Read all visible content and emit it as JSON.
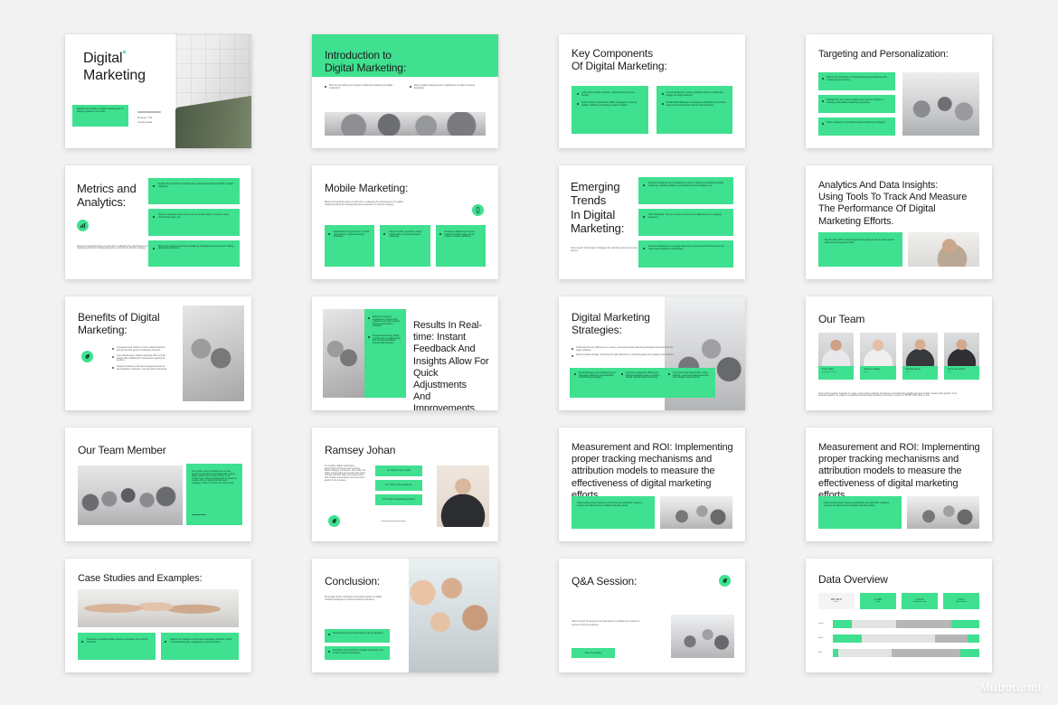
{
  "meta": {
    "watermark": "Mubou.net",
    "accent": "#3fe08f",
    "background": "#f2f2f2",
    "slide_bg": "#ffffff",
    "text_color": "#1b1b1b",
    "columns": 4,
    "rows": 5,
    "slide_count": 20
  },
  "slides": [
    {
      "index": 1,
      "name": "cover",
      "title_line1": "Digital",
      "title_line2": "Marketing",
      "green_block_text": "Highlight the benefits of digital marketing and its lasting relevance in the future.",
      "byline_line1": "Presenter: Visit",
      "byline_line2": "Creative Media",
      "photo": "architecture-walkway"
    },
    {
      "index": 2,
      "name": "introduction",
      "title_line1": "Introduction to",
      "title_line2": "Digital Marketing:",
      "bullets": [
        "What are the differences between traditional marketing and digital marketing?",
        "Define digital marketing and its significance in today's business landscape."
      ],
      "photo": "celebrating-people"
    },
    {
      "index": 3,
      "name": "key-components",
      "title_line1": "Key Components",
      "title_line2": "Of Digital Marketing:",
      "bullets_left": [
        "Learn about website structure, mobile friendly and user-friendly.",
        "Search Engine Optimization (SEO): Strategies to improve website visibility and ranking on search engines."
      ],
      "bullets_right": [
        "Content Marketing: Creating valuable content to attract and engage the target audience.",
        "Social Media Marketing: Leveraging social platforms for brand awareness and customer connect with customers."
      ]
    },
    {
      "index": 4,
      "name": "targeting-personalization",
      "title": "Targeting and Personalization:",
      "bullets": [
        "Discuss the importance of understanding target audiences and creating buyer personas.",
        "Highlight the role of data analytics and customer insights in creating personalized marketing experiences.",
        "Share examples of successful targeted marketing campaigns."
      ],
      "photo": "team-at-table"
    },
    {
      "index": 5,
      "name": "metrics-analytics",
      "title_line1": "Metrics and",
      "title_line2": "Analytics:",
      "body": "Metrics and analytics play a crucial role in evaluating the effectiveness of a digital marketing efforts and making data driven decisions to optimize strategy.",
      "bullets": [
        "Explain the importance of tracking key performance indicators (KPIs) in digital marketing.",
        "Discuss commonly used metrics such as website traffic, conversion rates, click-through rates, etc.",
        "Show how analytics tools help in obtaining campaign performance and making data-driven decisions."
      ],
      "badge_icon": "chart-badge-icon"
    },
    {
      "index": 6,
      "name": "mobile-marketing",
      "title": "Mobile Marketing:",
      "body": "Metrics and analytics play a crucial role in evaluating the effectiveness of a digital marketing efforts and making data driven decisions to optimize strategy.",
      "cards": [
        "Emphasize the significance of mobile optimization in digital marketing strategies.",
        "Discuss mobile responsive design, mobile apps, and location-based marketing.",
        "Showcase statistics and trends related to mobile usage and its impact on digital marketing."
      ],
      "badge_icon": "mobile-badge-icon"
    },
    {
      "index": 7,
      "name": "emerging-trends",
      "title_line1": "Emerging",
      "title_line2": "Trends",
      "title_line3": "In Digital",
      "title_line4": "Marketing:",
      "body": "Voice Search Optimization: Strategies for optimizing content for voice search queries.",
      "bullets": [
        "Artificial Intelligence (AI) and Machine Learning: How AI is transforming digital marketing, including chatbots, personalized recommendations, etc.",
        "Video Marketing: The rise of video content and its effectiveness in engaging audiences.",
        "Influencer Marketing: Leveraging influencers to promote products/services and reach target audiences authentically."
      ]
    },
    {
      "index": 8,
      "name": "analytics-data-insights",
      "title_line1": "Analytics And Data Insights:",
      "title_line2": "Using Tools To Track And Measure",
      "title_line3": "The Performance Of Digital",
      "title_line4": "Marketing Efforts.",
      "green_block_text": "Pay Per Click (PPC) Advertising: Running targeted ads to reach specific audiences and generate traffic.",
      "photo": "man-with-coffee"
    },
    {
      "index": 9,
      "name": "benefits",
      "title_line1": "Benefits of Digital",
      "title_line2": "Marketing:",
      "bullets": [
        "Increased reach: Ability to reach a global audience and get the best group of marketing channels.",
        "Cost-effectiveness: Digital marketing offers a lower budget than traditional for businesses requiring all services.",
        "Targeted marketing: Precise ad targeting based on demographics, behaviors, interests and preferences."
      ],
      "badge_icon": "leaf-badge-icon",
      "photo": "office-workers"
    },
    {
      "index": 10,
      "name": "real-time-results",
      "title_line1": "Results In Real-",
      "title_line2": "time: Instant",
      "title_line3": "Feedback And",
      "title_line4": "Insights Allow For",
      "title_line5": "Quick Adjustments",
      "title_line6": "And Improvements.",
      "bullets": [
        "Enhanced customer engagement: Interact with customers and gain insights through personalized channels.",
        "Targeted advertising: Ability to reach and re-targeting ads with increasing fashions through data followers."
      ],
      "photo": "people-collaborating"
    },
    {
      "index": 11,
      "name": "digital-marketing-strategies",
      "title_line1": "Digital Marketing",
      "title_line2": "Strategies:",
      "intro_bullets": [
        "Understand the key differences in content, and social media marketing campaigns that determine the target audience.",
        "Recommended strategy: Choosing the right platforms by combining goals and engaging with creators."
      ],
      "cards": [
        "Email Marketing: Email Marketing and Negotiation Effective personalization and PR-fitting strategies.",
        "Commerce Integration: Billing and selling/negotiating email, a positive change, benefits and ecommerce.",
        "Conversion Rate Optimization: Unify tracking, review and sales/conversion rate increase improvements."
      ],
      "photo": "women-at-desk"
    },
    {
      "index": 12,
      "name": "our-team",
      "title": "Our Team",
      "members": [
        {
          "name": "Tharr Alaa",
          "role": "Creative Director"
        },
        {
          "name": "Silvana Galaxy",
          "role": "CEO"
        },
        {
          "name": "Marissa Rose",
          "role": "CMO"
        },
        {
          "name": "Jamie Fernandz",
          "role": "CTO"
        }
      ],
      "footer": "Team works together tirelessly to create a team-driven strategy for business and marketing insights and also monitor social media growth. If any business goals fit, its visible to a dedicated social media business community. Contact us: 86 857 3697 talks us link."
    },
    {
      "index": 13,
      "name": "our-team-member",
      "title": "Our Team Member",
      "green_block_text": "Their goal is open marketing are an able aspect of converting trust-based with a prime target leaders one of every public, as an overall. If you have an opportunity to qualify as a sales office on digital methods and strategies, work us. Further, feel free to ask.",
      "photo": "business-team",
      "signature": "signature-line"
    },
    {
      "index": 14,
      "name": "ramsey-johan",
      "title": "Ramsey Johan",
      "body": "As a leader, digital marketing is determined for process and evolving. Below strategy, conversion, and evolve the traffic, social goals and specific and visual, through business ideas and media vision and creative and strategy and conversion goals for the business.",
      "steps": [
        "01. Define Your Goals",
        "02. Know Your Audience",
        "03. Create Compelling Content"
      ],
      "badge_icon": "leaf-badge-icon",
      "photo": "man-portrait"
    },
    {
      "index": 15,
      "name": "measurement-roi-a",
      "title_line1": "Measurement and ROI: Implementing",
      "title_line2": "proper tracking mechanisms and",
      "title_line3": "attribution models to measure the",
      "title_line4": "effectiveness of digital marketing efforts.",
      "green_block_text": "Implementing proper tracking mechanisms and attribution models to measure the effectiveness of digital marketing efforts.",
      "photo": "office-meeting"
    },
    {
      "index": 16,
      "name": "measurement-roi-b",
      "title_line1": "Measurement and ROI: Implementing",
      "title_line2": "proper tracking mechanisms and",
      "title_line3": "attribution models to measure the",
      "title_line4": "effectiveness of digital marketing efforts.",
      "green_block_text": "Implementing proper tracking mechanisms and attribution models to measure the effectiveness of digital marketing efforts.",
      "photo": "office-meeting"
    },
    {
      "index": 17,
      "name": "case-studies",
      "title": "Case Studies and Examples:",
      "bullets_left": [
        "Showcase successful digital marketing campaigns from various industries."
      ],
      "bullets_right": [
        "Analyze the strategies behind these campaigns and their impact on brand awareness, engagement, and conversions."
      ],
      "photo": "fist-bump-hands"
    },
    {
      "index": 18,
      "name": "conclusion",
      "title": "Conclusion:",
      "body": "Encourage further exploration and implementation of digital marketing strategies to achieve business objectives.",
      "bullets": [
        "Summarize key points discussed in the presentation.",
        "Emphasize the importance of digital marketing in the modern business landscape."
      ],
      "photo": "happy-team"
    },
    {
      "index": 19,
      "name": "qa-session",
      "title": "Q&A Session:",
      "body": "Open the floor for questions and discussions to address any queries or concerns from the audience.",
      "button_label": "Your Company",
      "badge_icon": "leaf-badge-icon",
      "photo": "boardroom-meeting"
    },
    {
      "index": 20,
      "name": "data-overview",
      "title": "Data Overview",
      "chart_data": {
        "type": "bar",
        "title": "Data Overview",
        "stats": [
          {
            "value": "367.93 K",
            "label": "Views",
            "style": "light"
          },
          {
            "value": "6 000",
            "label": "Likes",
            "style": "accent"
          },
          {
            "value": "1.23 %",
            "label": "Conversion rate",
            "style": "accent"
          },
          {
            "value": "2.8 K",
            "label": "New visitors",
            "style": "accent"
          }
        ],
        "categories": [
          "Social",
          "Email",
          "Paid"
        ],
        "series": [
          {
            "name": "Accent start",
            "values": [
              13,
              20,
              4
            ]
          },
          {
            "name": "Light mid",
            "values": [
              30,
              50,
              36
            ]
          },
          {
            "name": "Gray mid",
            "values": [
              38,
              22,
              47
            ]
          },
          {
            "name": "Accent end",
            "values": [
              19,
              8,
              13
            ]
          }
        ],
        "xlabel": "",
        "ylabel": "",
        "grid": false,
        "legend": "none"
      }
    }
  ]
}
